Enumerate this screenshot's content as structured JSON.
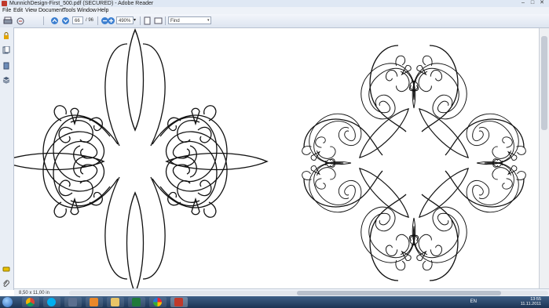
{
  "window": {
    "title": "MunnichDesign-First_500.pdf (SECURED) - Adobe Reader",
    "controls": [
      "minimize",
      "maximize",
      "close"
    ]
  },
  "menu": [
    "File",
    "Edit",
    "View",
    "Document",
    "Tools",
    "Window",
    "Help"
  ],
  "toolbar": {
    "page_current": "66",
    "page_total": "/ 96",
    "zoom": "490%",
    "find_placeholder": "Find"
  },
  "sidebar": {
    "icons": [
      "lock-icon",
      "pages-icon",
      "attachments-icon",
      "layers-icon",
      "comment-icon",
      "paperclip-icon"
    ]
  },
  "status": {
    "page_size": "8,50 x 11,00 in"
  },
  "taskbar": {
    "apps": [
      "chrome",
      "skype",
      "unknown-app",
      "media-player",
      "file-explorer",
      "excel",
      "picasa",
      "adobe-reader"
    ],
    "language": "EN",
    "time": "13:55",
    "date": "11.11.2011"
  },
  "colors": {
    "accent": "#c0392b",
    "taskbar": "#2a4870",
    "toolbar": "#dde5f0"
  }
}
